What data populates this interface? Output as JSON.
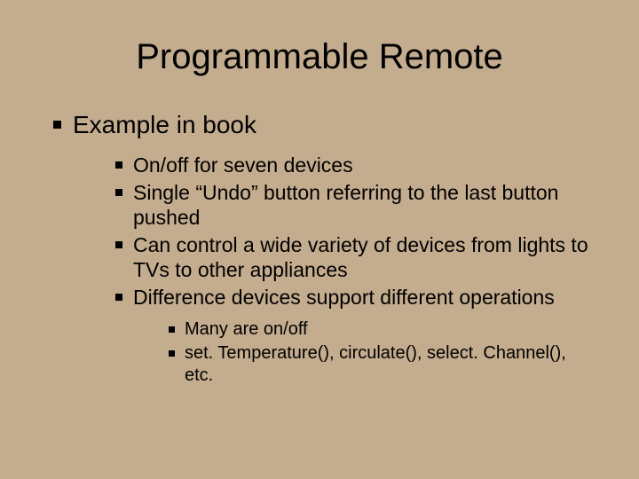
{
  "title": "Programmable Remote",
  "bullets": {
    "lvl1": [
      "Example in book"
    ],
    "lvl2": [
      "On/off for seven devices",
      "Single “Undo” button referring to the last button pushed",
      "Can control a wide variety of devices from lights to TVs to other appliances",
      "Difference devices support different operations"
    ],
    "lvl3": [
      "Many are on/off",
      "set. Temperature(), circulate(), select. Channel(), etc."
    ]
  }
}
